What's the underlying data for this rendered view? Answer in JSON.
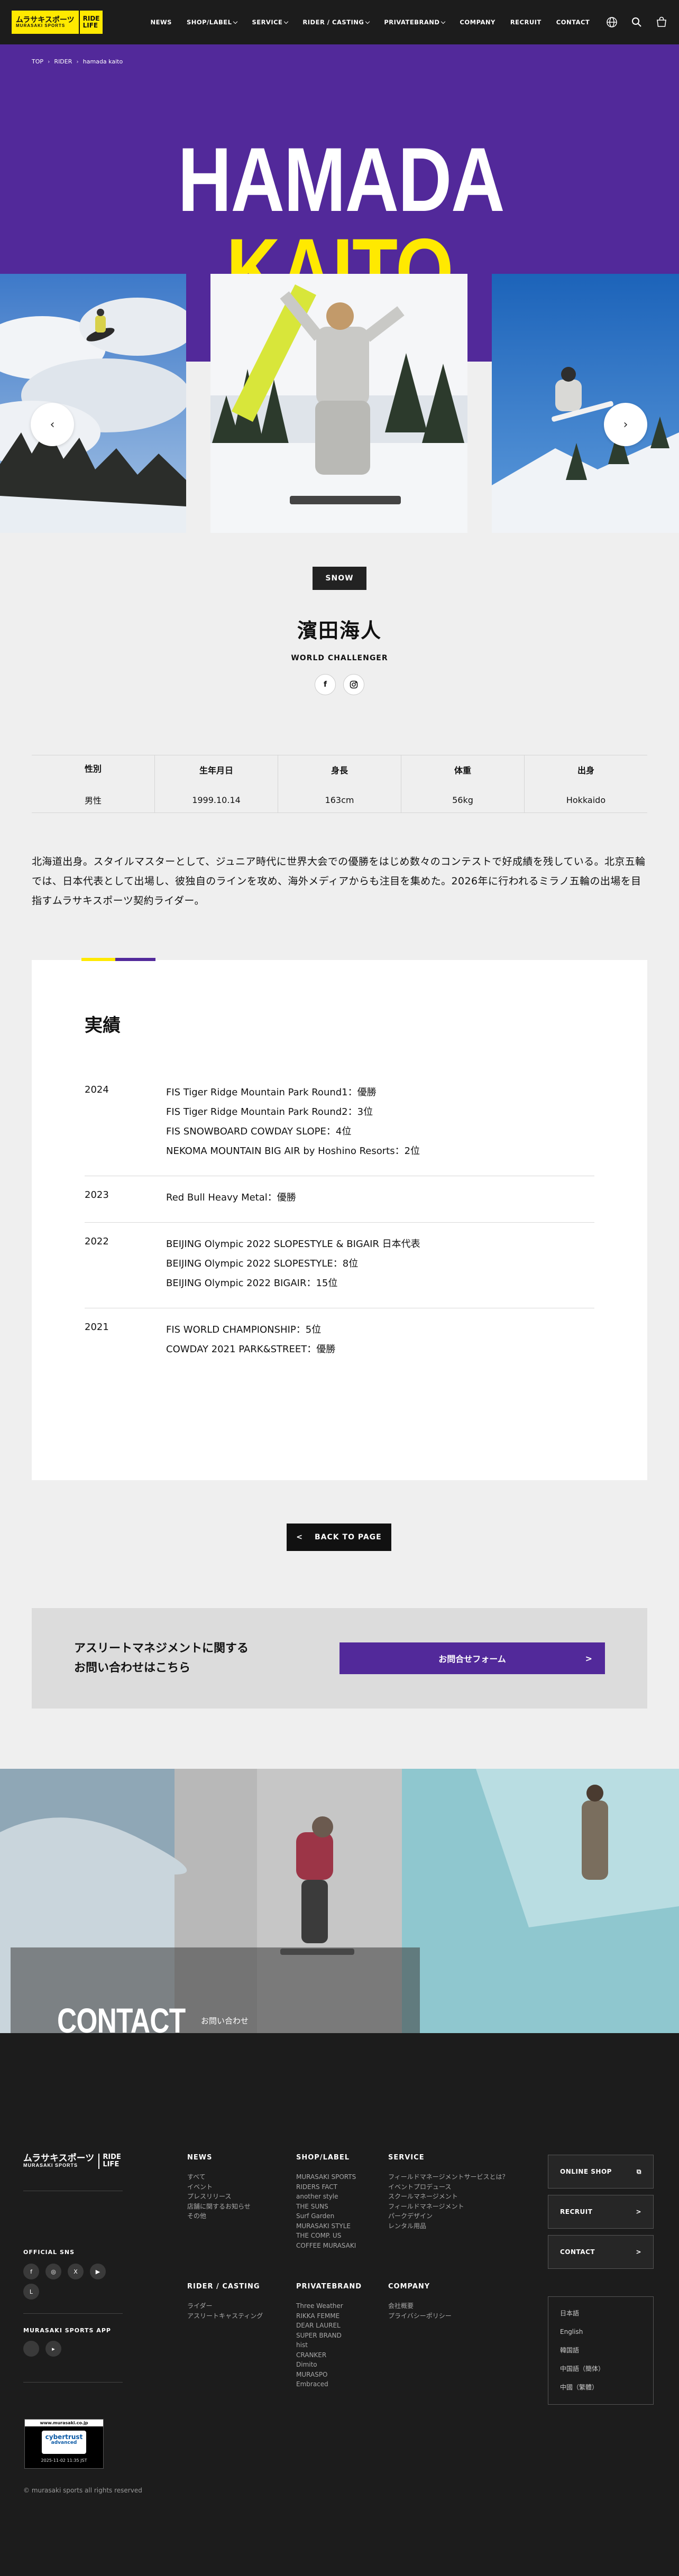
{
  "header": {
    "logo_main": "ムラサキスポーツ",
    "logo_sub": "MURASAKI SPORTS",
    "logo_ride": "RIDE",
    "logo_life": "LIFE",
    "nav": [
      {
        "label": "NEWS",
        "dropdown": false
      },
      {
        "label": "SHOP/LABEL",
        "dropdown": true
      },
      {
        "label": "SERVICE",
        "dropdown": true
      },
      {
        "label": "RIDER / CASTING",
        "dropdown": true
      },
      {
        "label": "PRIVATEBRAND",
        "dropdown": true
      },
      {
        "label": "COMPANY",
        "dropdown": false
      },
      {
        "label": "RECRUIT",
        "dropdown": false
      },
      {
        "label": "CONTACT",
        "dropdown": false
      }
    ]
  },
  "breadcrumb": [
    "TOP",
    "RIDER",
    "hamada kaito"
  ],
  "hero": {
    "first": "HAMADA",
    "last": "KAITO",
    "color": "#52299a",
    "accent": "#ffe900"
  },
  "profile": {
    "category": "SNOW",
    "name": "濱田海人",
    "tagline": "WORLD CHALLENGER",
    "social": [
      "facebook-icon",
      "instagram-icon"
    ]
  },
  "stats": [
    {
      "label": "性別",
      "value": "男性"
    },
    {
      "label": "生年月日",
      "value": "1999.10.14"
    },
    {
      "label": "身長",
      "value": "163cm"
    },
    {
      "label": "体重",
      "value": "56kg"
    },
    {
      "label": "出身",
      "value": "Hokkaido"
    }
  ],
  "bio": "北海道出身。スタイルマスターとして、ジュニア時代に世界大会での優勝をはじめ数々のコンテストで好成績を残している。北京五輪では、日本代表として出場し、彼独自のラインを攻め、海外メディアからも注目を集めた。2026年に行われるミラノ五輪の出場を目指すムラサキスポーツ契約ライダー。",
  "records": {
    "title": "実績",
    "rows": [
      {
        "year": "2024",
        "items": [
          "FIS Tiger Ridge Mountain Park Round1：優勝",
          "FIS Tiger Ridge Mountain Park Round2：3位",
          "FIS SNOWBOARD COWDAY SLOPE：4位",
          "NEKOMA MOUNTAIN BIG AIR by Hoshino Resorts：2位"
        ]
      },
      {
        "year": "2023",
        "items": [
          "Red Bull Heavy Metal：優勝"
        ]
      },
      {
        "year": "2022",
        "items": [
          "BEIJING Olympic 2022 SLOPESTYLE & BIGAIR 日本代表",
          "BEIJING Olympic 2022 SLOPESTYLE：8位",
          "BEIJING Olympic 2022 BIGAIR：15位"
        ]
      },
      {
        "year": "2021",
        "items": [
          "FIS WORLD CHAMPIONSHIP：5位",
          "COWDAY 2021 PARK&STREET：優勝"
        ]
      }
    ]
  },
  "back_label": "BACK TO PAGE",
  "cta": {
    "line1": "アスリートマネジメントに関する",
    "line2": "お問い合わせはこちら",
    "button": "お問合せフォーム"
  },
  "contact": {
    "title": "CONTACT",
    "subtitle": "お問い合わせ"
  },
  "footer": {
    "official_sns": "OFFICIAL SNS",
    "sns_icons": [
      "facebook-icon",
      "instagram-icon",
      "x-icon",
      "youtube-icon",
      "line-icon"
    ],
    "app_label": "MURASAKI SPORTS APP",
    "app_icons": [
      "apple-icon",
      "google-play-icon"
    ],
    "columns": [
      {
        "title": "NEWS",
        "items": [
          "すべて",
          "イベント",
          "プレスリリース",
          "店舗に関するお知らせ",
          "その他"
        ]
      },
      {
        "title": "SHOP/LABEL",
        "items": [
          "MURASAKI SPORTS",
          "RIDERS FACT",
          "another style",
          "THE SUNS",
          "Surf Garden",
          "MURASAKI STYLE",
          "THE COMP. US",
          "COFFEE MURASAKI"
        ]
      },
      {
        "title": "SERVICE",
        "items": [
          "フィールドマネージメントサービスとは？",
          "イベントプロデュース",
          "スクールマネージメント",
          "フィールドマネージメント",
          "パークデザイン",
          "レンタル用品"
        ]
      },
      {
        "title": "RIDER / CASTING",
        "items": [
          "ライダー",
          "アスリートキャスティング"
        ]
      },
      {
        "title": "PRIVATEBRAND",
        "items": [
          "Three Weather",
          "RIKKA FEMME",
          "DEAR LAUREL",
          "SUPER BRAND",
          "hist",
          "CRANKER",
          "Dimito",
          "MURASPO",
          "Embraced"
        ]
      },
      {
        "title": "COMPANY",
        "items": [
          "会社概要",
          "プライバシーポリシー"
        ]
      }
    ],
    "side_buttons": [
      "ONLINE SHOP",
      "RECRUIT",
      "CONTACT"
    ],
    "languages": [
      "日本語",
      "English",
      "韓国語",
      "中国語（簡体）",
      "中國（繁體）"
    ],
    "seal_url": "www.murasaki.co.jp",
    "seal_brand": "cybertrust",
    "seal_sub": "advanced",
    "seal_date": "2025-11-02 11:35 JST",
    "copyright": "© murasaki sports all rights reserved"
  }
}
